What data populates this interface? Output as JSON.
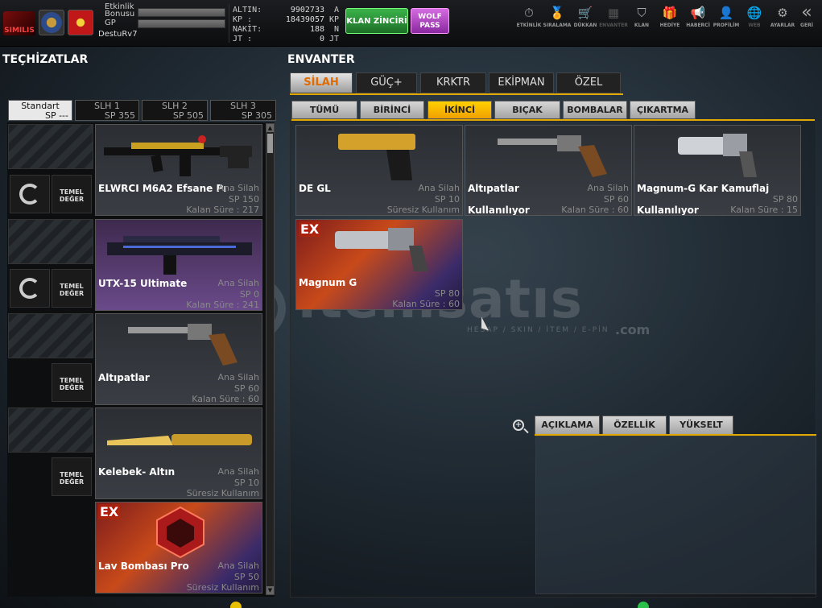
{
  "header": {
    "logo_text": "SIMILIS",
    "xp": {
      "label": "Etkinlik Bonusu",
      "gp_label": "GP",
      "username": "DestuRv7"
    },
    "currency": [
      {
        "key": "ALTIN:",
        "value": "9902733",
        "unit": "A"
      },
      {
        "key": "KP   :",
        "value": "18439057",
        "unit": "KP"
      },
      {
        "key": "NAKİT:",
        "value": "188",
        "unit": "N"
      },
      {
        "key": "JT   :",
        "value": "0",
        "unit": "JT"
      }
    ],
    "klan_button": "KLAN ZİNCİRİ",
    "wolf_button": "WOLF PASS",
    "nav": [
      {
        "icon": "stopwatch-icon",
        "glyph": "⏱",
        "label": "ETKİNLİK"
      },
      {
        "icon": "medal-icon",
        "glyph": "🏅",
        "label": "SIRALAMA"
      },
      {
        "icon": "cart-icon",
        "glyph": "🛒",
        "label": "DÜKKAN"
      },
      {
        "icon": "inventory-icon",
        "glyph": "▦",
        "label": "ENVANTER"
      },
      {
        "icon": "shield-icon",
        "glyph": "⛉",
        "label": "KLAN"
      },
      {
        "icon": "gift-icon",
        "glyph": "🎁",
        "label": "HEDİYE"
      },
      {
        "icon": "megaphone-icon",
        "glyph": "📢",
        "label": "HABERCİ"
      },
      {
        "icon": "profile-icon",
        "glyph": "👤",
        "label": "PROFİLİM"
      },
      {
        "icon": "globe-icon",
        "glyph": "🌐",
        "label": "WEB"
      },
      {
        "icon": "gear-icon",
        "glyph": "⚙",
        "label": "AYARLAR"
      },
      {
        "icon": "back-icon",
        "glyph": "«",
        "label": "GERİ"
      }
    ]
  },
  "left": {
    "title": "TEÇHİZATLAR",
    "slots": [
      {
        "name": "Standart",
        "sp": "SP ---"
      },
      {
        "name": "SLH 1",
        "sp": "SP 355"
      },
      {
        "name": "SLH 2",
        "sp": "SP 505"
      },
      {
        "name": "SLH 3",
        "sp": "SP 305"
      }
    ],
    "temel": "TEMEL DEĞER",
    "items": [
      {
        "name": "ELWRCI M6A2 Efsane Pı",
        "cat": "Ana Silah",
        "sp": "SP 150",
        "status": "Kalan Süre : 217"
      },
      {
        "name": "UTX-15 Ultimate",
        "cat": "Ana Silah",
        "sp": "SP 0",
        "status": "Kalan Süre : 241"
      },
      {
        "name": "Altıpatlar",
        "cat": "Ana Silah",
        "sp": "SP 60",
        "status": "Kalan Süre : 60"
      },
      {
        "name": "Kelebek- Altın",
        "cat": "Ana Silah",
        "sp": "SP 10",
        "status": "Süresiz Kullanım"
      },
      {
        "name": "Lav Bombası Pro",
        "cat": "Ana Silah",
        "sp": "SP 50",
        "status": "Süresiz Kullanım",
        "ex": "EX"
      }
    ]
  },
  "right": {
    "title": "ENVANTER",
    "tabs": [
      "SİLAH",
      "GÜÇ+",
      "KRKTR",
      "EKİPMAN",
      "ÖZEL"
    ],
    "subtabs": [
      "TÜMÜ",
      "BİRİNCİ",
      "İKİNCİ",
      "BIÇAK",
      "BOMBALAR",
      "ÇIKARTMA"
    ],
    "items": [
      {
        "name": "DE GL",
        "cat": "Ana Silah",
        "sp": "SP 10",
        "status": "Süresiz Kullanım",
        "used": ""
      },
      {
        "name": "Altıpatlar",
        "cat": "Ana Silah",
        "sp": "SP 60",
        "status": "Kalan Süre : 60",
        "used": "Kullanılıyor"
      },
      {
        "name": "Magnum-G Kar Kamuflaj",
        "cat": "",
        "sp": "SP 80",
        "status": "Kalan Süre : 15",
        "used": "Kullanılıyor"
      },
      {
        "name": "Magnum G",
        "cat": "",
        "sp": "SP 80",
        "status": "Kalan Süre : 60",
        "used": "",
        "ex": "EX"
      }
    ],
    "detail_tabs": [
      "AÇIKLAMA",
      "ÖZELLİK",
      "YÜKSELT"
    ]
  },
  "watermark": {
    "text": "itemsatıs",
    "sub": "HESAP / SKIN / İTEM / E-PİN",
    "com": ".com"
  }
}
